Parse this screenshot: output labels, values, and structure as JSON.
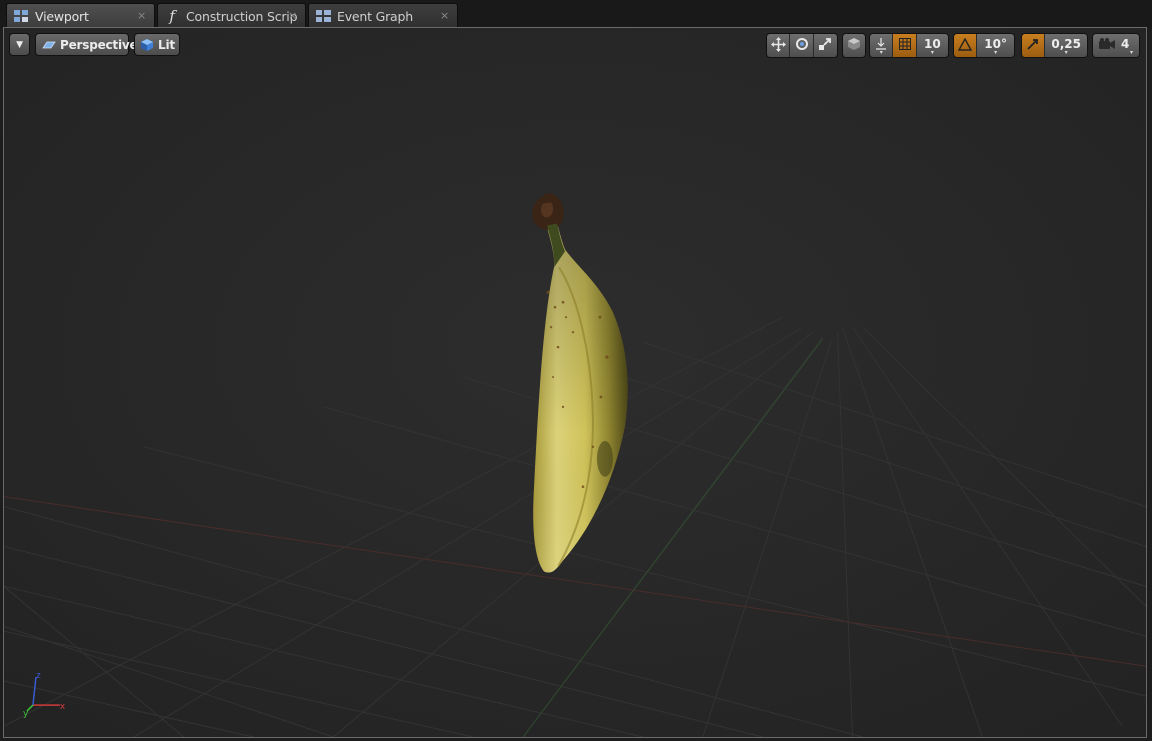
{
  "tabs": [
    {
      "label": "Viewport",
      "icon": "viewport-grid-icon",
      "close": "×",
      "active": true
    },
    {
      "label": "Construction Scrip",
      "icon": "function-icon",
      "close": "×",
      "active": false
    },
    {
      "label": "Event Graph",
      "icon": "event-graph-icon",
      "close": "×",
      "active": false
    }
  ],
  "viewport": {
    "menu_icon": "chevron-down-icon",
    "view_mode_label": "Perspective",
    "lighting_label": "Lit",
    "grid_snap_value": "10",
    "rotation_snap_value": "10°",
    "scale_snap_value": "0,25",
    "camera_speed_value": "4",
    "object": "banana-mesh"
  },
  "colors": {
    "snap_active": "#c87e1f",
    "viewport_bg": "#262626",
    "axis_x": "#d23a3a",
    "axis_y": "#3ac43a",
    "axis_z": "#3a5ad2"
  }
}
